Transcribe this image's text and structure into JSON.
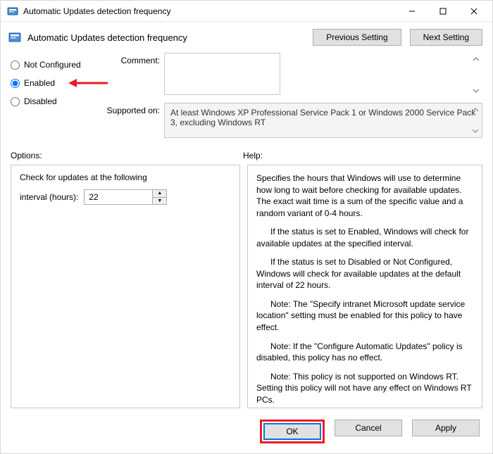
{
  "window": {
    "title": "Automatic Updates detection frequency"
  },
  "header": {
    "title": "Automatic Updates detection frequency",
    "prev_label": "Previous Setting",
    "next_label": "Next Setting"
  },
  "radios": {
    "not_configured": "Not Configured",
    "enabled": "Enabled",
    "disabled": "Disabled",
    "selected": "enabled"
  },
  "fields": {
    "comment_label": "Comment:",
    "comment_value": "",
    "supported_label": "Supported on:",
    "supported_value": "At least Windows XP Professional Service Pack 1 or Windows 2000 Service Pack 3, excluding Windows RT"
  },
  "sections": {
    "options_label": "Options:",
    "help_label": "Help:"
  },
  "options": {
    "line1": "Check for updates at the following",
    "interval_label": "interval (hours):",
    "interval_value": "22"
  },
  "help": {
    "p1": "Specifies the hours that Windows will use to determine how long to wait before checking for available updates. The exact wait time is a sum of the specific value and a random variant of 0-4 hours.",
    "p2": "      If the status is set to Enabled, Windows will check for available updates at the specified interval.",
    "p3": "      If the status is set to Disabled or Not Configured, Windows will check for available updates at the default interval of 22 hours.",
    "p4": "      Note: The \"Specify intranet Microsoft update service location\" setting must be enabled for this policy to have effect.",
    "p5": "      Note: If the \"Configure Automatic Updates\" policy is disabled, this policy has no effect.",
    "p6": "      Note: This policy is not supported on Windows RT. Setting this policy will not have any effect on Windows RT PCs."
  },
  "footer": {
    "ok": "OK",
    "cancel": "Cancel",
    "apply": "Apply"
  }
}
